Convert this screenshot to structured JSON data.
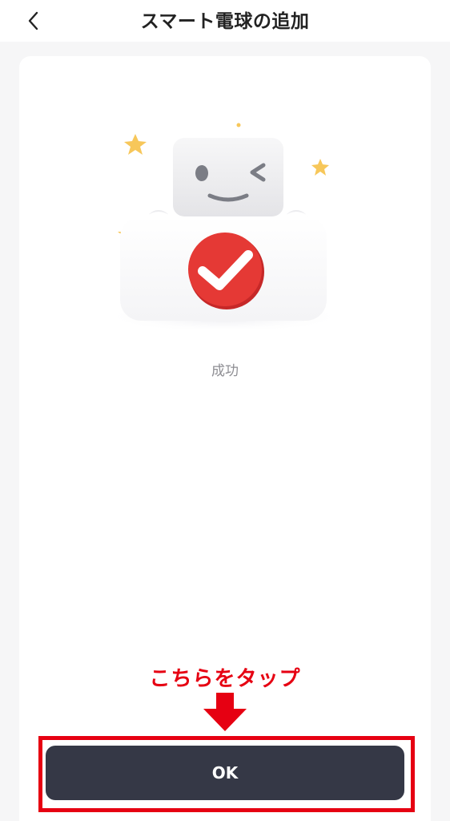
{
  "header": {
    "back_icon": "chevron-left-icon",
    "title": "スマート電球の追加"
  },
  "main": {
    "illustration_icon": "success-robot-check-icon",
    "status_text": "成功"
  },
  "annotation": {
    "text": "こちらをタップ",
    "arrow_icon": "arrow-down-icon",
    "color": "#e60012"
  },
  "footer": {
    "ok_label": "OK",
    "button_color": "#353846"
  },
  "colors": {
    "check_red": "#e53935",
    "star_yellow": "#f7c75a"
  }
}
